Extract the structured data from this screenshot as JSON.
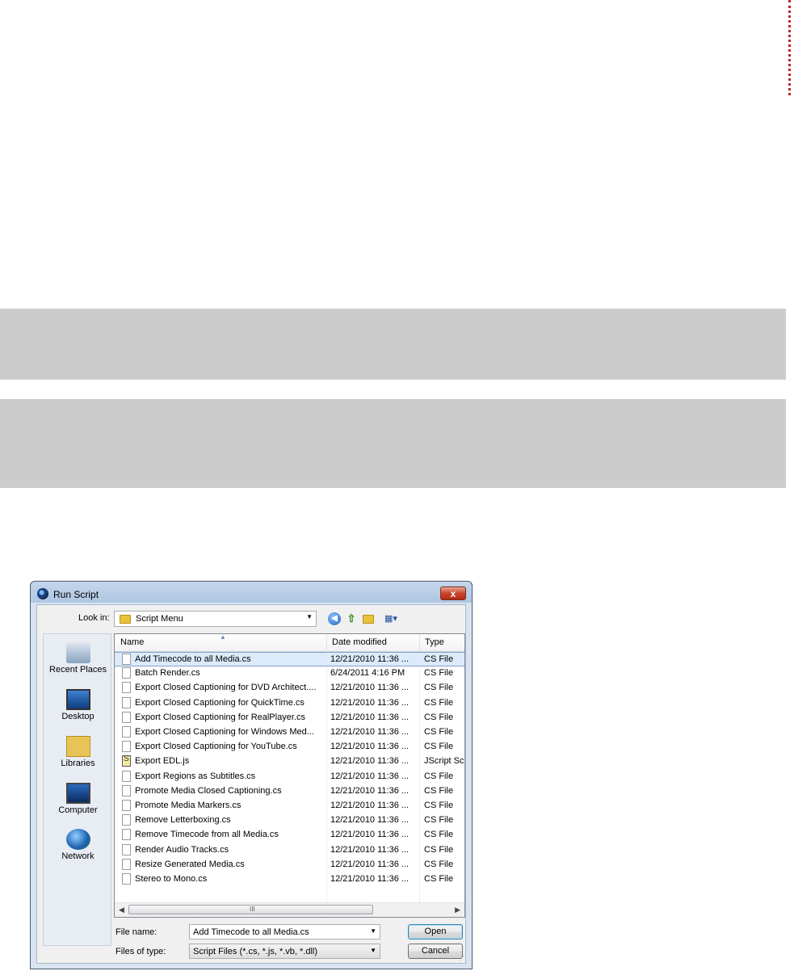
{
  "dialog": {
    "title": "Run Script",
    "close_label": "x"
  },
  "look_in": {
    "label": "Look in:",
    "value": "Script Menu"
  },
  "toolbar": {
    "back_icon": "back-arrow-icon",
    "up_icon": "up-folder-icon",
    "new_folder_icon": "new-folder-icon",
    "views_icon": "views-menu-icon",
    "views_label": "▦▾"
  },
  "places": [
    {
      "label": "Recent Places",
      "icon": "recent-places-icon"
    },
    {
      "label": "Desktop",
      "icon": "desktop-icon"
    },
    {
      "label": "Libraries",
      "icon": "libraries-icon"
    },
    {
      "label": "Computer",
      "icon": "computer-icon"
    },
    {
      "label": "Network",
      "icon": "network-icon"
    }
  ],
  "columns": {
    "name": "Name",
    "date": "Date modified",
    "type": "Type"
  },
  "files": [
    {
      "name": "Add Timecode to all Media.cs",
      "date": "12/21/2010 11:36 ...",
      "type": "CS File",
      "selected": true
    },
    {
      "name": "Batch Render.cs",
      "date": "6/24/2011 4:16 PM",
      "type": "CS File"
    },
    {
      "name": "Export Closed Captioning for DVD Architect....",
      "date": "12/21/2010 11:36 ...",
      "type": "CS File"
    },
    {
      "name": "Export Closed Captioning for QuickTime.cs",
      "date": "12/21/2010 11:36 ...",
      "type": "CS File"
    },
    {
      "name": "Export Closed Captioning for RealPlayer.cs",
      "date": "12/21/2010 11:36 ...",
      "type": "CS File"
    },
    {
      "name": "Export Closed Captioning for Windows Med...",
      "date": "12/21/2010 11:36 ...",
      "type": "CS File"
    },
    {
      "name": "Export Closed Captioning for YouTube.cs",
      "date": "12/21/2010 11:36 ...",
      "type": "CS File"
    },
    {
      "name": "Export EDL.js",
      "date": "12/21/2010 11:36 ...",
      "type": "JScript Scr",
      "js": true
    },
    {
      "name": "Export Regions as Subtitles.cs",
      "date": "12/21/2010 11:36 ...",
      "type": "CS File"
    },
    {
      "name": "Promote Media Closed Captioning.cs",
      "date": "12/21/2010 11:36 ...",
      "type": "CS File"
    },
    {
      "name": "Promote Media Markers.cs",
      "date": "12/21/2010 11:36 ...",
      "type": "CS File"
    },
    {
      "name": "Remove Letterboxing.cs",
      "date": "12/21/2010 11:36 ...",
      "type": "CS File"
    },
    {
      "name": "Remove Timecode from all Media.cs",
      "date": "12/21/2010 11:36 ...",
      "type": "CS File"
    },
    {
      "name": "Render Audio Tracks.cs",
      "date": "12/21/2010 11:36 ...",
      "type": "CS File"
    },
    {
      "name": "Resize Generated Media.cs",
      "date": "12/21/2010 11:36 ...",
      "type": "CS File"
    },
    {
      "name": "Stereo to Mono.cs",
      "date": "12/21/2010 11:36 ...",
      "type": "CS File"
    }
  ],
  "scrollbar": {
    "grip": "III"
  },
  "file_name": {
    "label": "File name:",
    "value": "Add Timecode to all Media.cs"
  },
  "file_type": {
    "label": "Files of type:",
    "value": "Script Files (*.cs, *.js, *.vb, *.dll)"
  },
  "buttons": {
    "open": "Open",
    "cancel": "Cancel"
  },
  "colors": {
    "band": "#cccccc",
    "dotted_marker": "#c0262e",
    "selection": "#dcebfc"
  }
}
